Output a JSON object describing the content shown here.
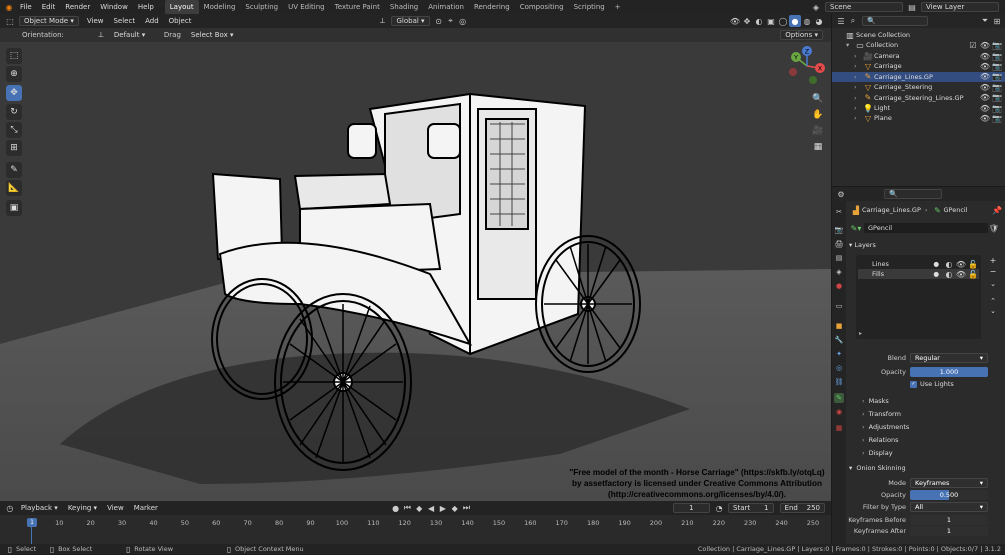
{
  "menu": [
    "File",
    "Edit",
    "Render",
    "Window",
    "Help"
  ],
  "workspaces": [
    "Layout",
    "Modeling",
    "Sculpting",
    "UV Editing",
    "Texture Paint",
    "Shading",
    "Animation",
    "Rendering",
    "Compositing",
    "Scripting",
    "+"
  ],
  "scene": "Scene",
  "view_layer": "View Layer",
  "viewport": {
    "mode": "Object Mode",
    "menu": [
      "View",
      "Select",
      "Add",
      "Object"
    ],
    "transform_space": "Global",
    "orientation_label": "Orientation:",
    "orientation_value": "Default",
    "drag_label": "Drag",
    "drag_value": "Select Box",
    "options": "Options",
    "credit": [
      "\"Free model of the month - Horse Carriage\" (https://skfb.ly/otqLq)",
      "by assetfactory is licensed under Creative Commons Attribution",
      "(http://creativecommons.org/licenses/by/4.0/)."
    ],
    "gizmo_axes": [
      "X",
      "Y",
      "Z"
    ]
  },
  "timeline": {
    "menu": [
      "Playback",
      "Keying",
      "View",
      "Marker"
    ],
    "current_frame": "1",
    "start_label": "Start",
    "start": "1",
    "end_label": "End",
    "end": "250",
    "ticks": [
      "1",
      "10",
      "20",
      "30",
      "40",
      "50",
      "60",
      "70",
      "80",
      "90",
      "100",
      "110",
      "120",
      "130",
      "140",
      "150",
      "160",
      "170",
      "180",
      "190",
      "200",
      "210",
      "220",
      "230",
      "240",
      "250"
    ]
  },
  "status": {
    "items": [
      "Select",
      "Box Select",
      "Rotate View",
      "Object Context Menu"
    ],
    "right": "Collection | Carriage_Lines.GP | Layers:0 | Frames:0 | Strokes:0 | Points:0 | Objects:0/7 | 3.1.2"
  },
  "outliner": {
    "root": "Scene Collection",
    "collection": "Collection",
    "items": [
      {
        "name": "Camera",
        "selected": false
      },
      {
        "name": "Carriage",
        "selected": false
      },
      {
        "name": "Carriage_Lines.GP",
        "selected": true
      },
      {
        "name": "Carriage_Steering",
        "selected": false
      },
      {
        "name": "Carriage_Steering_Lines.GP",
        "selected": false
      },
      {
        "name": "Light",
        "selected": false
      },
      {
        "name": "Plane",
        "selected": false
      }
    ]
  },
  "properties": {
    "breadcrumb_object": "Carriage_Lines.GP",
    "breadcrumb_data": "GPencil",
    "datablock": "GPencil",
    "layers_title": "Layers",
    "layers": [
      "Lines",
      "Fills"
    ],
    "blend_label": "Blend",
    "blend_value": "Regular",
    "opacity_label": "Opacity",
    "opacity_value": "1.000",
    "use_lights": "Use Lights",
    "sections": [
      "Masks",
      "Transform",
      "Adjustments",
      "Relations",
      "Display"
    ],
    "onion_title": "Onion Skinning",
    "onion_mode_label": "Mode",
    "onion_mode": "Keyframes",
    "onion_opacity_label": "Opacity",
    "onion_opacity": "0.500",
    "filter_label": "Filter by Type",
    "filter_value": "All",
    "kf_before_label": "Keyframes Before",
    "kf_before": "1",
    "kf_after_label": "Keyframes After",
    "kf_after": "1"
  },
  "colors": {
    "accent": "#4772b3",
    "selected": "#334d80",
    "background": "#3d3d3d"
  }
}
